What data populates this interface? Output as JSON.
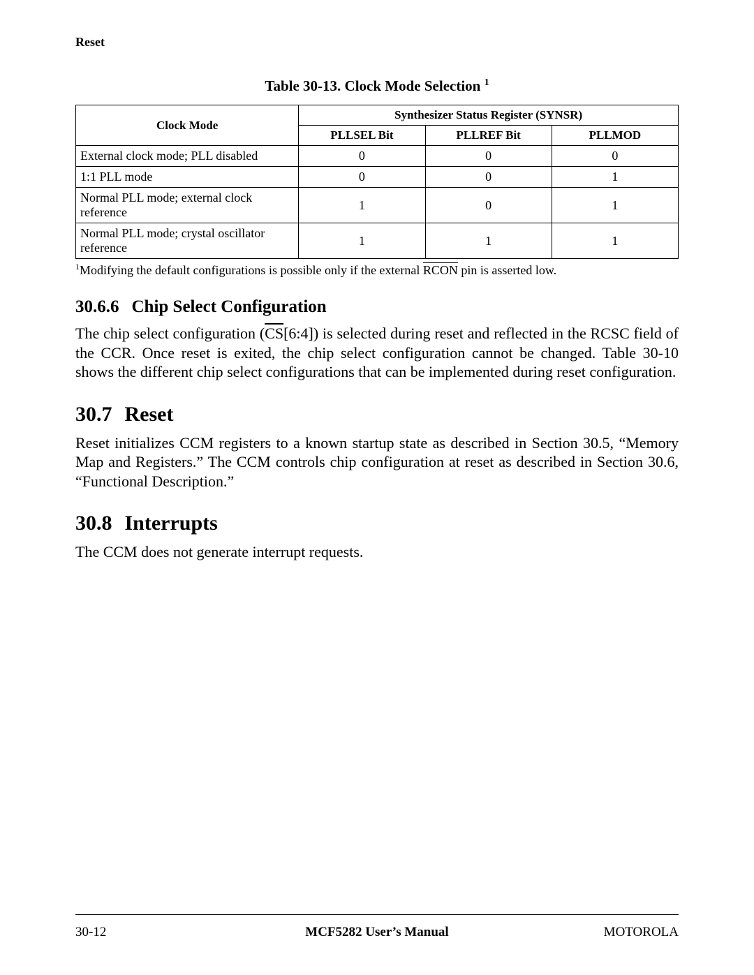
{
  "running_head": "Reset",
  "table": {
    "caption_prefix": "Table 30-13. Clock Mode Selection ",
    "caption_sup": "1",
    "col_mode": "Clock Mode",
    "col_group": "Synthesizer Status Register (SYNSR)",
    "col_pllsel": "PLLSEL Bit",
    "col_pllref": "PLLREF Bit",
    "col_pllmod": "PLLMOD",
    "rows": [
      {
        "mode": "External clock mode; PLL disabled",
        "pllsel": "0",
        "pllref": "0",
        "pllmod": "0"
      },
      {
        "mode": "1:1 PLL mode",
        "pllsel": "0",
        "pllref": "0",
        "pllmod": "1"
      },
      {
        "mode": "Normal PLL mode; external clock reference",
        "pllsel": "1",
        "pllref": "0",
        "pllmod": "1"
      },
      {
        "mode": "Normal PLL mode; crystal oscillator reference",
        "pllsel": "1",
        "pllref": "1",
        "pllmod": "1"
      }
    ]
  },
  "footnote": {
    "sup": "1",
    "before": "Modifying the default configurations is possible only if the external ",
    "overline": "RCON",
    "after": " pin is asserted low."
  },
  "sec3066": {
    "num": "30.6.6",
    "title": "Chip Select Configuration",
    "para_before": "The chip select configuration (",
    "para_over": "CS",
    "para_mid": "[6:4]) is selected during reset and reflected in the RCSC field of the CCR. Once reset is exited, the chip select configuration cannot be changed. Table 30-10 shows the different chip select configurations that can be implemented during reset configuration."
  },
  "sec307": {
    "num": "30.7",
    "title": "Reset",
    "para": "Reset initializes CCM registers to a known startup state as described in Section 30.5, “Memory Map and Registers.” The CCM controls chip configuration at reset as described in Section 30.6, “Functional Description.”"
  },
  "sec308": {
    "num": "30.8",
    "title": "Interrupts",
    "para": "The CCM does not generate interrupt requests."
  },
  "footer": {
    "left": "30-12",
    "center": "MCF5282 User’s Manual",
    "right": "MOTOROLA"
  }
}
